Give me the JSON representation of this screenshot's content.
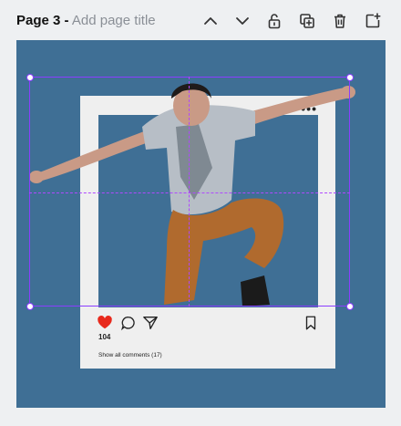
{
  "toolbar": {
    "page_label": "Page 3",
    "separator": "-",
    "title_placeholder": "Add page title",
    "icons": [
      "chevron-up-icon",
      "chevron-down-icon",
      "unlock-icon",
      "duplicate-icon",
      "trash-icon",
      "add-page-icon"
    ]
  },
  "post": {
    "likes": "104",
    "comments_link": "Show all comments (17)",
    "more": "•••"
  },
  "colors": {
    "canvas": "#3f6f95",
    "frame": "#efefef",
    "selection": "#8b3dff",
    "heart": "#e8291c"
  }
}
